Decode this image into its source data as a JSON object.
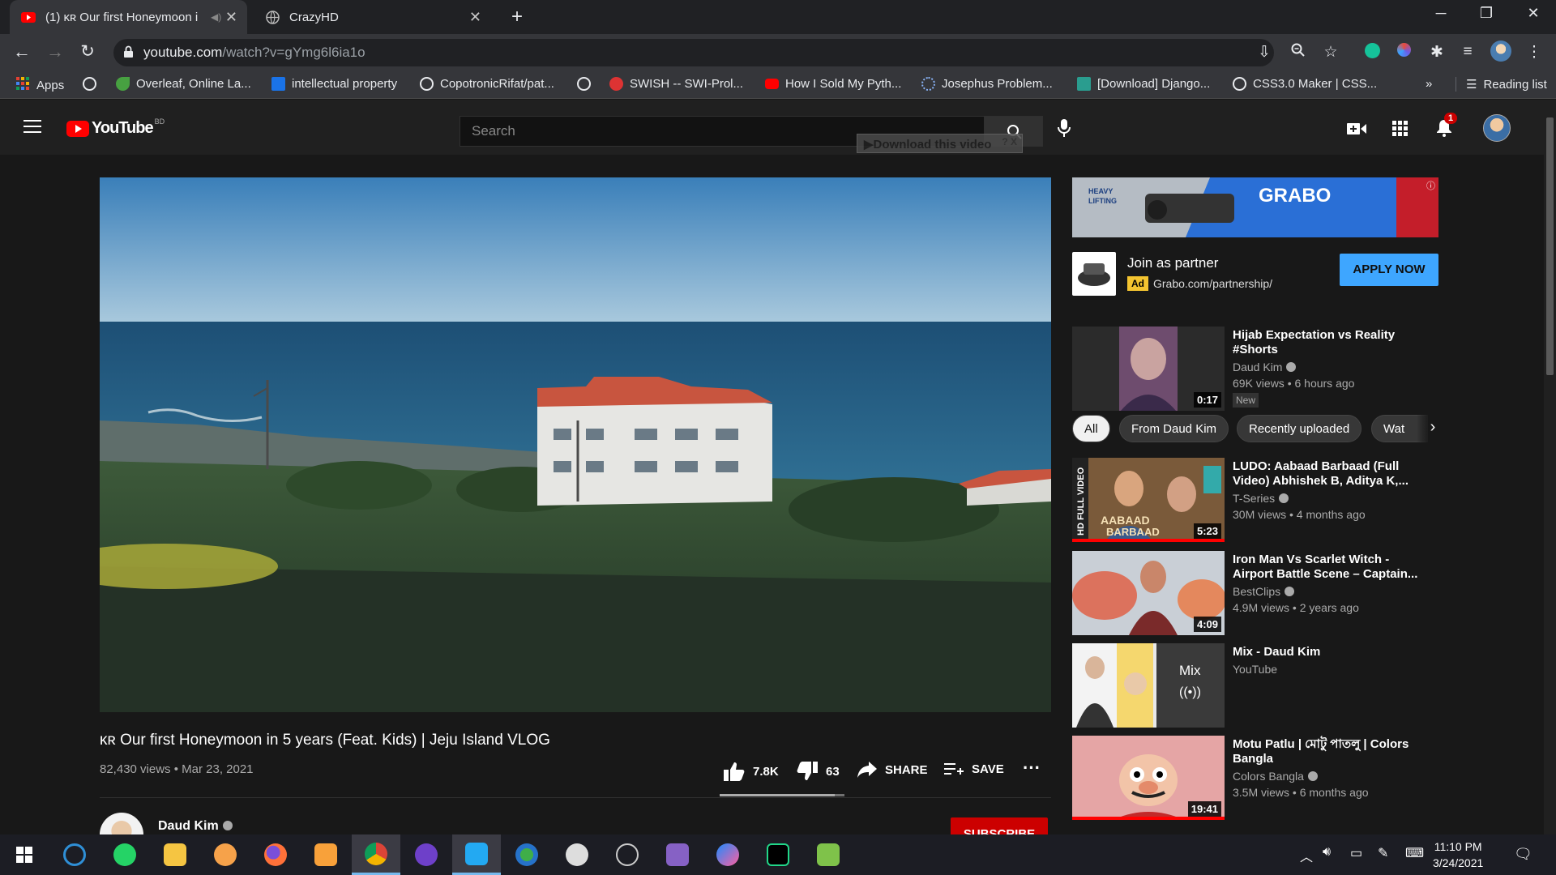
{
  "browser": {
    "tabs": [
      {
        "label": "(1) ĸʀ Our first Honeymoon i",
        "active": true
      },
      {
        "label": "CrazyHD",
        "active": false
      }
    ],
    "url_domain": "youtube.com",
    "url_path": "/watch?v=gYmg6l6ia1o",
    "bookmarks": [
      {
        "label": "Apps",
        "icon": "apps-grid-icon"
      },
      {
        "label": "",
        "icon": "globe-icon"
      },
      {
        "label": "Overleaf, Online La...",
        "icon": "overleaf-icon"
      },
      {
        "label": "intellectual property",
        "icon": "s-icon"
      },
      {
        "label": "CopotronicRifat/pat...",
        "icon": "github-icon"
      },
      {
        "label": "",
        "icon": "globe-icon"
      },
      {
        "label": "SWISH -- SWI-Prol...",
        "icon": "swish-icon"
      },
      {
        "label": "How I Sold My Pyth...",
        "icon": "youtube-icon"
      },
      {
        "label": "Josephus Problem...",
        "icon": "loading-icon"
      },
      {
        "label": "[Download] Django...",
        "icon": "django-icon"
      },
      {
        "label": "CSS3.0 Maker | CSS...",
        "icon": "globe-icon"
      }
    ],
    "bookmarks_more": "»",
    "reading_list": "Reading list"
  },
  "youtube": {
    "logo_text": "YouTube",
    "country_code": "BD",
    "search_placeholder": "Search",
    "download_overlay": "▶Download this video",
    "notification_count": "1"
  },
  "video": {
    "title": "ĸʀ Our first Honeymoon in 5 years (Feat. Kids) | Jeju Island VLOG",
    "meta": "82,430 views • Mar 23, 2021",
    "likes": "7.8K",
    "dislikes": "63",
    "like_ratio": 0.92,
    "share_label": "SHARE",
    "save_label": "SAVE",
    "channel_name": "Daud Kim",
    "subscribe_label": "SUBSCRIBE"
  },
  "ad": {
    "banner_text": "GRABO",
    "title": "Join as partner",
    "badge": "Ad",
    "url": "Grabo.com/partnership/",
    "cta": "APPLY NOW"
  },
  "chips": [
    "All",
    "From Daud Kim",
    "Recently uploaded",
    "Wat"
  ],
  "recommendations": [
    {
      "title": "Hijab Expectation vs Reality #Shorts",
      "channel": "Daud Kim",
      "meta": "69K views • 6 hours ago",
      "duration": "0:17",
      "badge": "New",
      "color": "#4a3a4a"
    },
    {
      "title": "LUDO: Aabaad Barbaad (Full Video) Abhishek B, Aditya K,...",
      "channel": "T-Series",
      "meta": "30M views • 4 months ago",
      "duration": "5:23",
      "color": "#6a4a3a",
      "progress": 1.0
    },
    {
      "title": "Iron Man Vs Scarlet Witch - Airport Battle Scene – Captain...",
      "channel": "BestClips",
      "meta": "4.9M views • 2 years ago",
      "duration": "4:09",
      "color": "#5a3a3a"
    },
    {
      "title": "Mix - Daud Kim",
      "channel": "YouTube",
      "meta": "",
      "duration": "Mix",
      "color": "#5a5a5a"
    },
    {
      "title": "Motu Patlu | মোটু পাতলু | Colors Bangla",
      "channel": "Colors Bangla",
      "meta": "3.5M views • 6 months ago",
      "duration": "19:41",
      "color": "#c24a4a",
      "progress": 1.0
    }
  ],
  "taskbar": {
    "time": "11:10 PM",
    "date": "3/24/2021"
  }
}
